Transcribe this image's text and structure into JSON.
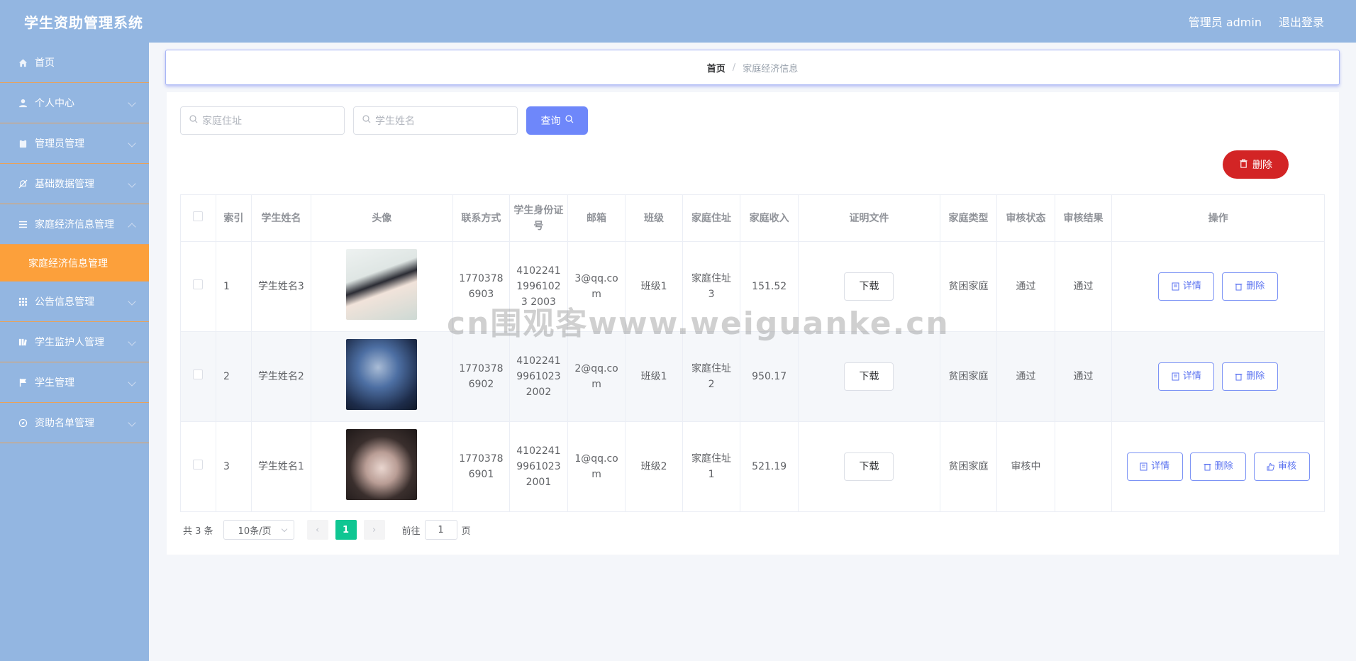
{
  "app": {
    "title": "学生资助管理系统"
  },
  "header": {
    "user_label": "管理员 admin",
    "logout_label": "退出登录"
  },
  "sidebar": {
    "items": [
      {
        "label": "首页",
        "icon": "home-icon"
      },
      {
        "label": "个人中心",
        "icon": "user-icon"
      },
      {
        "label": "管理员管理",
        "icon": "clipboard-icon"
      },
      {
        "label": "基础数据管理",
        "icon": "bell-off-icon"
      },
      {
        "label": "家庭经济信息管理",
        "icon": "menu-icon"
      },
      {
        "label": "家庭经济信息管理",
        "icon": "submenu"
      },
      {
        "label": "公告信息管理",
        "icon": "grid-icon"
      },
      {
        "label": "学生监护人管理",
        "icon": "book-icon"
      },
      {
        "label": "学生管理",
        "icon": "flag-icon"
      },
      {
        "label": "资助名单管理",
        "icon": "compass-icon"
      }
    ]
  },
  "breadcrumb": {
    "home": "首页",
    "separator": "/",
    "current": "家庭经济信息"
  },
  "search": {
    "address_placeholder": "家庭住址",
    "name_placeholder": "学生姓名",
    "query_label": "查询"
  },
  "toolbar": {
    "delete_label": "删除"
  },
  "table": {
    "headers": [
      "索引",
      "学生姓名",
      "头像",
      "联系方式",
      "学生身份证号",
      "邮箱",
      "班级",
      "家庭住址",
      "家庭收入",
      "证明文件",
      "家庭类型",
      "审核状态",
      "审核结果",
      "操作"
    ],
    "rows": [
      {
        "index": "1",
        "name": "学生姓名3",
        "phone": "17703786903",
        "id_card": "410224119961023 2003",
        "email": "3@qq.com",
        "class": "班级1",
        "address": "家庭住址3",
        "income": "151.52",
        "file": "下载",
        "type": "贫困家庭",
        "status": "通过",
        "result": "通过",
        "ops": [
          "详情",
          "删除"
        ]
      },
      {
        "index": "2",
        "name": "学生姓名2",
        "phone": "17703786902",
        "id_card": "410224199610232002",
        "email": "2@qq.com",
        "class": "班级1",
        "address": "家庭住址2",
        "income": "950.17",
        "file": "下载",
        "type": "贫困家庭",
        "status": "通过",
        "result": "通过",
        "ops": [
          "详情",
          "删除"
        ]
      },
      {
        "index": "3",
        "name": "学生姓名1",
        "phone": "17703786901",
        "id_card": "410224199610232001",
        "email": "1@qq.com",
        "class": "班级2",
        "address": "家庭住址1",
        "income": "521.19",
        "file": "下载",
        "type": "贫困家庭",
        "status": "审核中",
        "result": "",
        "ops": [
          "详情",
          "删除",
          "审核"
        ]
      }
    ]
  },
  "pagination": {
    "total_label": "共 3 条",
    "page_size": "10条/页",
    "current_page": "1",
    "goto_label": "前往",
    "goto_value": "1",
    "page_unit": "页"
  },
  "watermark": "cn围观客www.weiguanke.cn"
}
